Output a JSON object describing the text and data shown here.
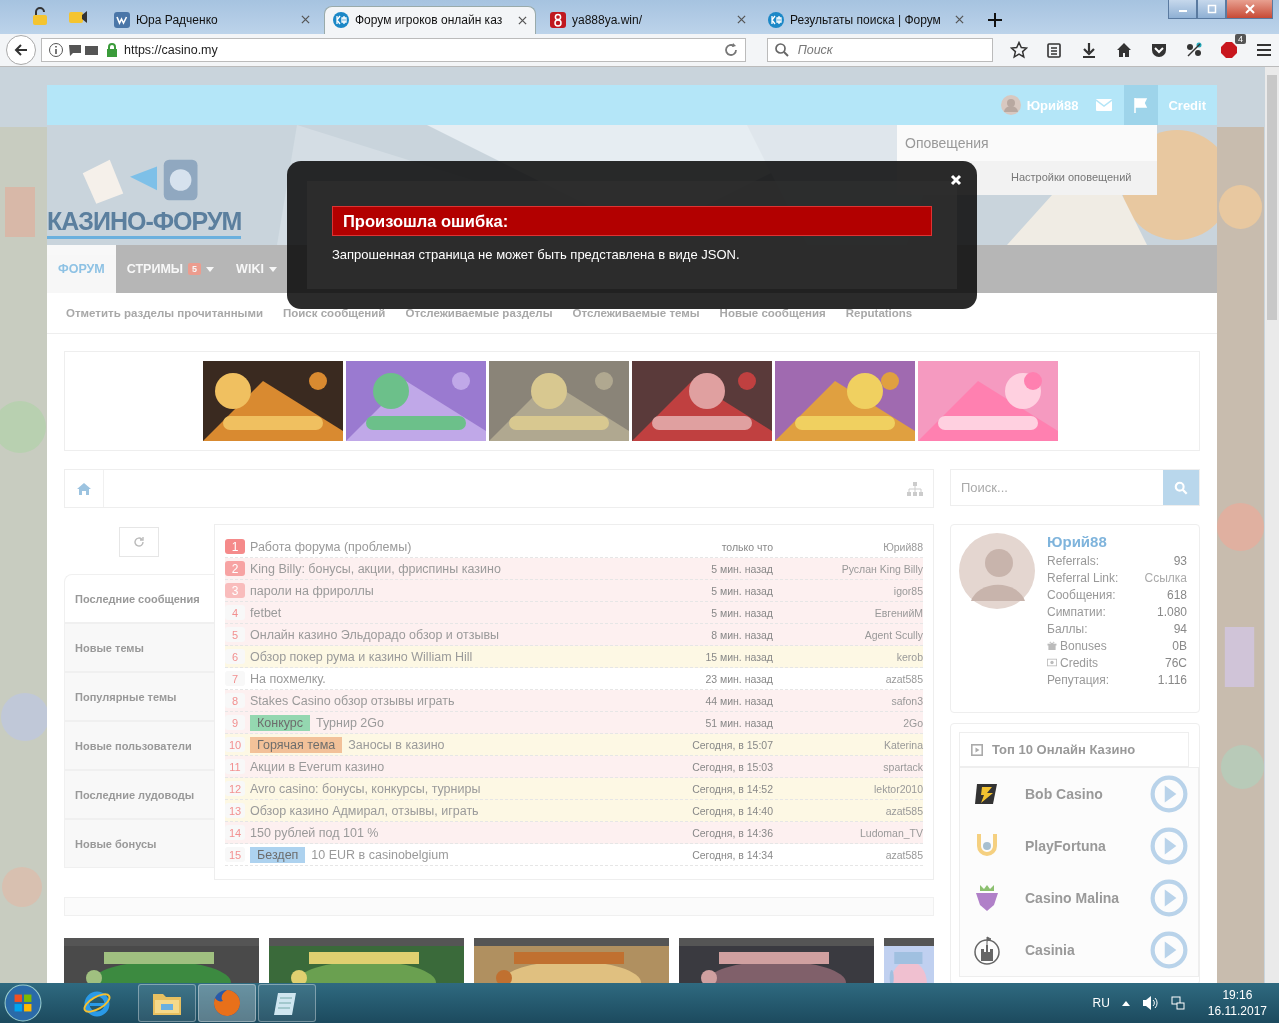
{
  "browser": {
    "tabs": [
      {
        "title": "Юра Радченко",
        "kind": "vk",
        "selected": false
      },
      {
        "title": "Форум игроков онлайн каз",
        "kind": "forum",
        "selected": true
      },
      {
        "title": "ya888ya.win/",
        "kind": "eight",
        "selected": false
      },
      {
        "title": "Результаты поиска | Форум",
        "kind": "forum",
        "selected": false
      }
    ],
    "url": "https://casino.my",
    "search_placeholder": "Поиск",
    "addon_badge": "4"
  },
  "site": {
    "top_bar": {
      "user": "Юрий88",
      "credit": "Credit"
    },
    "logo": "КАЗИНО-ФОРУМ",
    "notifications": {
      "title": "Оповещения",
      "links": [
        "Настройки оповещений"
      ]
    },
    "nav": [
      {
        "label": "ФОРУМ",
        "selected": true,
        "dropdown": false
      },
      {
        "label": "СТРИМЫ",
        "badge": "5",
        "selected": false,
        "dropdown": true
      },
      {
        "label": "WIKI",
        "selected": false,
        "dropdown": true
      }
    ],
    "subnav": [
      "Отметить разделы прочитанными",
      "Поиск сообщений",
      "Отслеживаемые разделы",
      "Отслеживаемые темы",
      "Новые сообщения",
      "Reputations"
    ],
    "banners": [
      {
        "kind": "picture"
      },
      {
        "kind": "picture"
      },
      {
        "kind": "picture"
      },
      {
        "kind": "picture"
      },
      {
        "kind": "picture"
      },
      {
        "kind": "picture"
      }
    ],
    "search": {
      "placeholder": "Поиск..."
    },
    "feed_tabs": [
      {
        "label": "Последние сообщения",
        "selected": true
      },
      {
        "label": "Новые темы",
        "selected": false
      },
      {
        "label": "Популярные темы",
        "selected": false
      },
      {
        "label": "Новые пользователи",
        "selected": false
      },
      {
        "label": "Последние лудоводы",
        "selected": false
      },
      {
        "label": "Новые бонусы",
        "selected": false
      }
    ],
    "topics": [
      {
        "number": "1",
        "badge": {
          "color": "#f58a8a"
        },
        "title": "Работа форума (проблемы)",
        "time": "только что",
        "author": "Юрий88",
        "color": "#ffffff"
      },
      {
        "number": "2",
        "badge": {
          "color": "#f7a3a3"
        },
        "title": "King Billy: бонусы, акции, фриспины казино",
        "time": "5 мин. назад",
        "author": "Руслан King Billy",
        "color": "#fdf0f0"
      },
      {
        "number": "3",
        "badge": {
          "color": "#f9bcbc"
        },
        "title": "пароли на фрироллы",
        "time": "5 мин. назад",
        "author": "igor85",
        "color": "#fdf0f0"
      },
      {
        "number": "4",
        "title": "fetbet",
        "time": "5 мин. назад",
        "author": "ЕвгенийМ",
        "color": "#fdf0f0"
      },
      {
        "number": "5",
        "title": "Онлайн казино Эльдорадо обзор и отзывы",
        "time": "8 мин. назад",
        "author": "Agent Scully",
        "color": "#fdf0f0"
      },
      {
        "number": "6",
        "title": "Обзор покер рума и казино William Hill",
        "time": "15 мин. назад",
        "author": "kerob",
        "color": "#fdf8e4"
      },
      {
        "number": "7",
        "title": "На похмелку.",
        "time": "23 мин. назад",
        "author": "azat585",
        "color": "#ffffff"
      },
      {
        "number": "8",
        "title": "Stakes Casino обзор отзывы играть",
        "time": "44 мин. назад",
        "author": "safon3",
        "color": "#fdf0f0"
      },
      {
        "number": "9",
        "tag": {
          "text": "Конкурс",
          "color": "#8fd6ad"
        },
        "title": "Турнир 2Go",
        "time": "51 мин. назад",
        "author": "2Go",
        "color": "#fdf0f0"
      },
      {
        "number": "10",
        "tag": {
          "text": "Горячая тема",
          "color": "#f2bf95"
        },
        "title": "Заносы в казино",
        "time": "Сегодня, в 15:07",
        "author": "Katerina",
        "color": "#fdf8e4"
      },
      {
        "number": "11",
        "title": "Акции в Everum казино",
        "time": "Сегодня, в 15:03",
        "author": "spartack",
        "color": "#fdf0f0"
      },
      {
        "number": "12",
        "title": "Avro casino: бонусы, конкурсы, турниры",
        "time": "Сегодня, в 14:52",
        "author": "lektor2010",
        "color": "#fdf8e4"
      },
      {
        "number": "13",
        "title": "Обзор казино Адмирал, отзывы, играть",
        "time": "Сегодня, в 14:40",
        "author": "azat585",
        "color": "#fdf8e4"
      },
      {
        "number": "14",
        "title": "150 рублей под 101 %",
        "time": "Сегодня, в 14:36",
        "author": "Ludoman_TV",
        "color": "#fdf0f0"
      },
      {
        "number": "15",
        "tag": {
          "text": "Бездеп",
          "color": "#a9d0ef"
        },
        "title": "10 EUR в casinobelgium",
        "time": "Сегодня, в 14:34",
        "author": "azat585",
        "color": "#ffffff"
      }
    ],
    "profile": {
      "name": "Юрий88",
      "stats": [
        {
          "label": "Referrals:",
          "value": "93",
          "kind": "plain"
        },
        {
          "label": "Referral Link:",
          "value": "Ссылка",
          "kind": "link"
        },
        {
          "label": "Сообщения:",
          "value": "618",
          "kind": "plain"
        },
        {
          "label": "Симпатии:",
          "value": "1.080",
          "kind": "plain"
        },
        {
          "label": "Баллы:",
          "value": "94",
          "kind": "plain"
        },
        {
          "label": "Bonuses",
          "value": "0B",
          "kind": "gift"
        },
        {
          "label": "Credits",
          "value": "76C",
          "kind": "money"
        },
        {
          "label": "Репутация:",
          "value": "1.116",
          "kind": "plain"
        }
      ]
    },
    "top_casinos": {
      "title": "Топ 10 Онлайн Казино",
      "items": [
        {
          "name": "Bob Casino",
          "kind": "bolt"
        },
        {
          "name": "PlayFortuna",
          "kind": "horseshoe"
        },
        {
          "name": "Casino Malina",
          "kind": "berry"
        },
        {
          "name": "Casinia",
          "kind": "castle"
        }
      ]
    },
    "thumbnails": [
      {
        "kind": "picture"
      },
      {
        "kind": "picture"
      },
      {
        "kind": "picture"
      },
      {
        "kind": "picture"
      },
      {
        "kind": "picture"
      }
    ]
  },
  "dialog": {
    "title": "Произошла ошибка:",
    "message": "Запрошенная страница не может быть представлена в виде JSON."
  },
  "taskbar": {
    "apps": [
      {
        "kind": "ie",
        "active": false
      },
      {
        "kind": "folder",
        "active": false
      },
      {
        "kind": "firefox",
        "active": true
      },
      {
        "kind": "notepad",
        "active": false
      }
    ],
    "language": "RU",
    "time": "19:16",
    "date": "16.11.2017"
  }
}
